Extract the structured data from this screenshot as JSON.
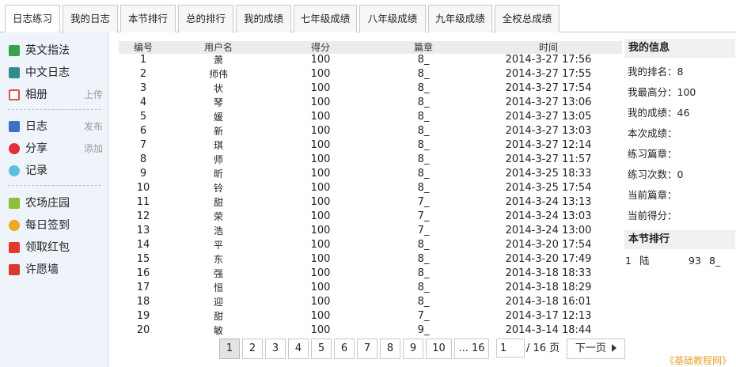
{
  "tabs": [
    {
      "label": "日志练习"
    },
    {
      "label": "我的日志"
    },
    {
      "label": "本节排行"
    },
    {
      "label": "总的排行"
    },
    {
      "label": "我的成绩"
    },
    {
      "label": "七年级成绩"
    },
    {
      "label": "八年级成绩"
    },
    {
      "label": "九年级成绩"
    },
    {
      "label": "全校总成绩"
    }
  ],
  "sidebar": {
    "items": [
      {
        "label": "英文指法",
        "action": "",
        "icon": "keyboard-icon",
        "color": "#3aa24a"
      },
      {
        "label": "中文日志",
        "action": "",
        "icon": "keyboard-icon",
        "color": "#2f8c8c"
      },
      {
        "label": "相册",
        "action": "上传",
        "icon": "photo-icon",
        "color": "#d9534f"
      },
      {
        "label": "日志",
        "action": "发布",
        "icon": "blog-icon",
        "color": "#3b6fc8"
      },
      {
        "label": "分享",
        "action": "添加",
        "icon": "share-icon",
        "color": "#e0303c"
      },
      {
        "label": "记录",
        "action": "",
        "icon": "chat-icon",
        "color": "#5bc0de"
      },
      {
        "label": "农场庄园",
        "action": "",
        "icon": "farm-icon",
        "color": "#8bbf3c"
      },
      {
        "label": "每日签到",
        "action": "",
        "icon": "smile-icon",
        "color": "#f0a81e"
      },
      {
        "label": "领取红包",
        "action": "",
        "icon": "red-packet-icon",
        "color": "#e23b2e"
      },
      {
        "label": "许愿墙",
        "action": "",
        "icon": "wish-wall-icon",
        "color": "#d9372f"
      }
    ]
  },
  "table": {
    "headers": {
      "id": "编号",
      "user": "用户名",
      "score": "得分",
      "chapter": "篇章",
      "time": "时间"
    },
    "rows": [
      {
        "id": "1",
        "user": "萧",
        "score": "100",
        "chapter": "8_",
        "time": "2014-3-27 17:56"
      },
      {
        "id": "2",
        "user": "师伟",
        "score": "100",
        "chapter": "8_",
        "time": "2014-3-27 17:55"
      },
      {
        "id": "3",
        "user": "状",
        "score": "100",
        "chapter": "8_",
        "time": "2014-3-27 17:54"
      },
      {
        "id": "4",
        "user": "琴",
        "score": "100",
        "chapter": "8_",
        "time": "2014-3-27 13:06"
      },
      {
        "id": "5",
        "user": "媛",
        "score": "100",
        "chapter": "8_",
        "time": "2014-3-27 13:05"
      },
      {
        "id": "6",
        "user": "新",
        "score": "100",
        "chapter": "8_",
        "time": "2014-3-27 13:03"
      },
      {
        "id": "7",
        "user": "琪",
        "score": "100",
        "chapter": "8_",
        "time": "2014-3-27 12:14"
      },
      {
        "id": "8",
        "user": "师",
        "score": "100",
        "chapter": "8_",
        "time": "2014-3-27 11:57"
      },
      {
        "id": "9",
        "user": "昕",
        "score": "100",
        "chapter": "8_",
        "time": "2014-3-25 18:33"
      },
      {
        "id": "10",
        "user": "铃",
        "score": "100",
        "chapter": "8_",
        "time": "2014-3-25 17:54"
      },
      {
        "id": "11",
        "user": "甜",
        "score": "100",
        "chapter": "7_",
        "time": "2014-3-24 13:13"
      },
      {
        "id": "12",
        "user": "荣",
        "score": "100",
        "chapter": "7_",
        "time": "2014-3-24 13:03"
      },
      {
        "id": "13",
        "user": "浩",
        "score": "100",
        "chapter": "7_",
        "time": "2014-3-24 13:00"
      },
      {
        "id": "14",
        "user": "平",
        "score": "100",
        "chapter": "8_",
        "time": "2014-3-20 17:54"
      },
      {
        "id": "15",
        "user": "东",
        "score": "100",
        "chapter": "8_",
        "time": "2014-3-20 17:49"
      },
      {
        "id": "16",
        "user": "强",
        "score": "100",
        "chapter": "8_",
        "time": "2014-3-18 18:33"
      },
      {
        "id": "17",
        "user": "恒",
        "score": "100",
        "chapter": "8_",
        "time": "2014-3-18 18:29"
      },
      {
        "id": "18",
        "user": "迎",
        "score": "100",
        "chapter": "8_",
        "time": "2014-3-18 16:01"
      },
      {
        "id": "19",
        "user": "甜",
        "score": "100",
        "chapter": "7_",
        "time": "2014-3-17 12:13"
      },
      {
        "id": "20",
        "user": "敏",
        "score": "100",
        "chapter": "9_",
        "time": "2014-3-14 18:44"
      }
    ]
  },
  "pagination": {
    "pages": [
      "1",
      "2",
      "3",
      "4",
      "5",
      "6",
      "7",
      "8",
      "9",
      "10",
      "... 16"
    ],
    "current": "1",
    "input_value": "1",
    "total": "/ 16 页",
    "next_label": "下一页",
    "next_icon": "triangle-right-icon"
  },
  "info": {
    "title": "我的信息",
    "lines": [
      "我的排名：8",
      "我最高分：100",
      "我的成绩：46",
      "本次成绩：",
      "练习篇章：",
      "练习次数：0",
      "当前篇章：",
      "当前得分："
    ]
  },
  "ranking": {
    "title": "本节排行",
    "rows": [
      {
        "rank": "1",
        "name": "陆",
        "score": "93",
        "chapter": "8_"
      }
    ]
  },
  "watermark": "《基础教程网》"
}
